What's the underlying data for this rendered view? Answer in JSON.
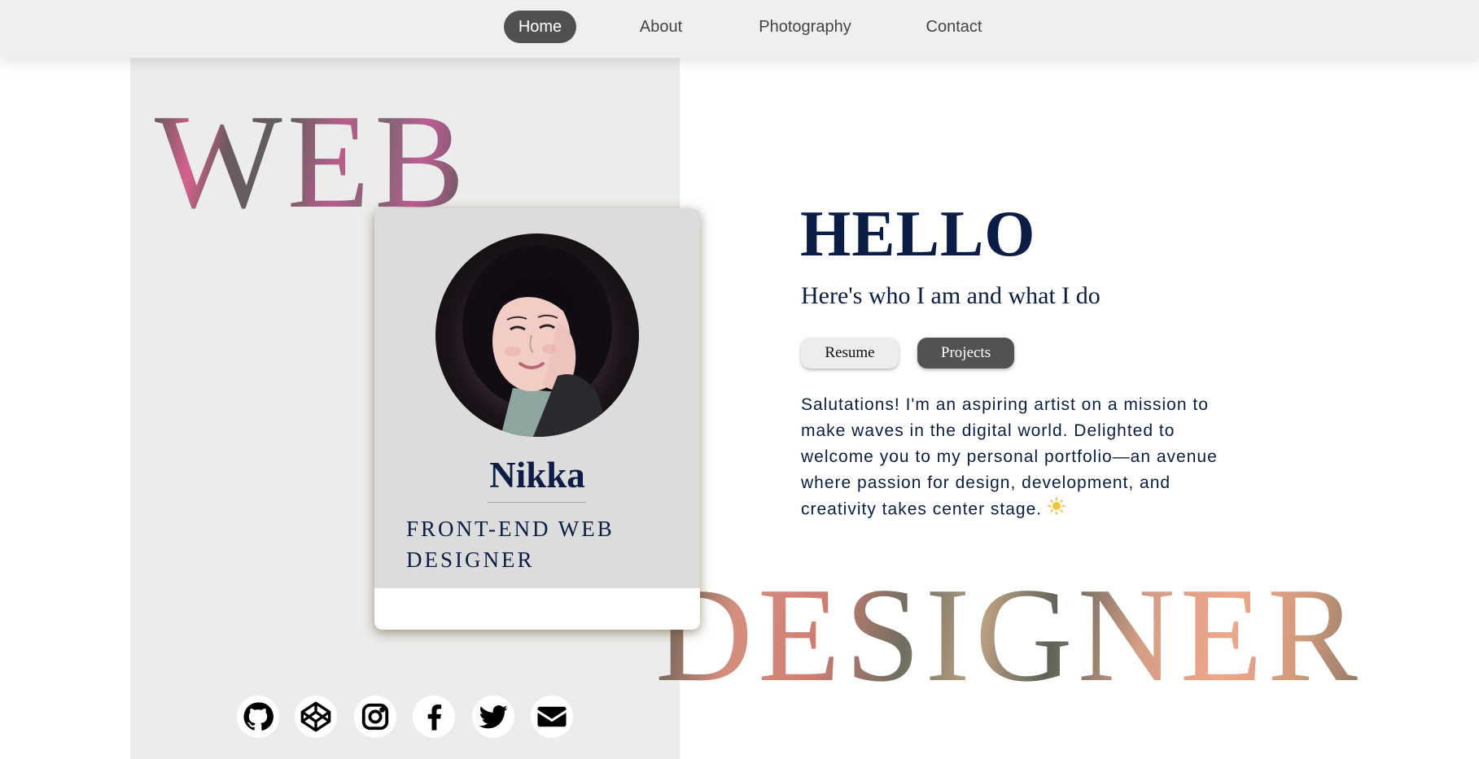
{
  "nav": {
    "items": [
      {
        "label": "Home",
        "active": true
      },
      {
        "label": "About",
        "active": false
      },
      {
        "label": "Photography",
        "active": false
      },
      {
        "label": "Contact",
        "active": false
      }
    ]
  },
  "hero": {
    "word_top": "WEB",
    "word_bottom": "DESIGNER"
  },
  "profile": {
    "name": "Nikka",
    "role": "FRONT-END WEB DESIGNER"
  },
  "social": {
    "icons": [
      "github-icon",
      "codepen-icon",
      "instagram-icon",
      "facebook-icon",
      "twitter-icon",
      "email-icon"
    ]
  },
  "intro": {
    "heading": "HELLO",
    "subtitle": "Here's who I am and what I do",
    "resume_label": "Resume",
    "projects_label": "Projects",
    "bio": "Salutations! I'm an aspiring artist on a mission to make waves in the digital world. Delighted to welcome you to my personal portfolio—an avenue where passion for design, development, and creativity takes center stage."
  },
  "colors": {
    "navy": "#0b1d44",
    "nav_bg": "#efefef",
    "active_pill": "#505050",
    "panel_bg": "#ececec",
    "card_bg": "#dcdcdc"
  }
}
